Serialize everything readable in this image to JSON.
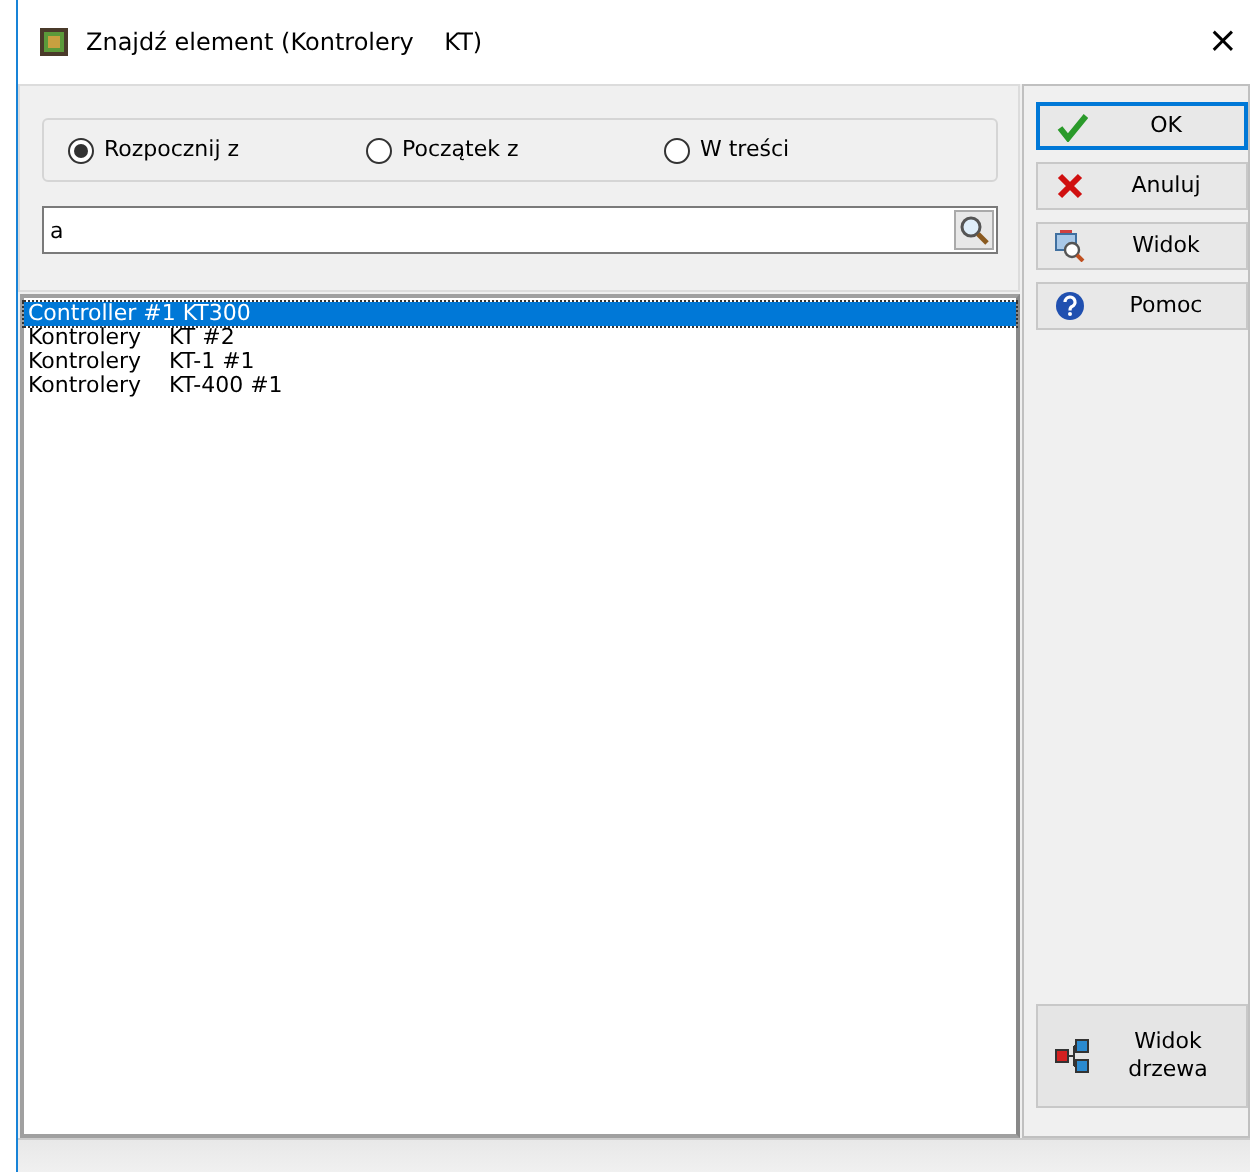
{
  "window": {
    "title": "Znajdź element (Kontrolery    KT)",
    "close": "×"
  },
  "radios": [
    {
      "label": "Rozpocznij z",
      "selected": true
    },
    {
      "label": "Początek z",
      "selected": false
    },
    {
      "label": "W treści",
      "selected": false
    }
  ],
  "search": {
    "value": "a"
  },
  "items": [
    {
      "text": "Controller #1 KT300",
      "selected": true
    },
    {
      "text": "Kontrolery    KT #2",
      "selected": false
    },
    {
      "text": "Kontrolery    KT-1 #1",
      "selected": false
    },
    {
      "text": "Kontrolery    KT-400 #1",
      "selected": false
    }
  ],
  "buttons": [
    {
      "label": "OK",
      "kind": "ok"
    },
    {
      "label": "Anuluj",
      "kind": "cancel"
    },
    {
      "label": "Widok",
      "kind": "view"
    },
    {
      "label": "Pomoc",
      "kind": "help"
    }
  ],
  "tree_button": {
    "label": "Widok drzewa"
  }
}
